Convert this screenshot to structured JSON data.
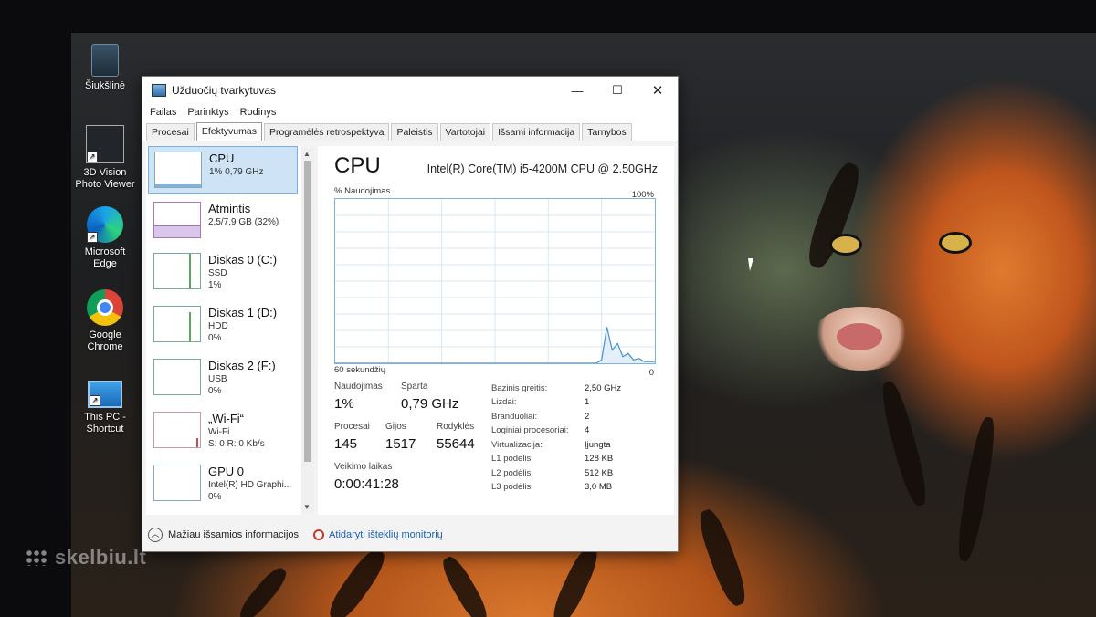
{
  "desktop": {
    "watermark": "skelbiu.lt",
    "icons": [
      {
        "name": "recycle-bin",
        "label": "Šiukšlinė"
      },
      {
        "name": "photo-viewer",
        "label": "3D Vision Photo Viewer"
      },
      {
        "name": "edge",
        "label": "Microsoft Edge"
      },
      {
        "name": "chrome",
        "label": "Google Chrome"
      },
      {
        "name": "this-pc",
        "label": "This PC - Shortcut"
      }
    ]
  },
  "window": {
    "title": "Užduočių tvarkytuvas",
    "controls": {
      "minimize": "—",
      "maximize": "☐",
      "close": "✕"
    },
    "menu": [
      "Failas",
      "Parinktys",
      "Rodinys"
    ],
    "tabs": [
      "Procesai",
      "Efektyvumas",
      "Programėlės retrospektyva",
      "Paleistis",
      "Vartotojai",
      "Išsami informacija",
      "Tarnybos"
    ],
    "active_tab": "Efektyvumas",
    "resources": [
      {
        "name": "CPU",
        "sub1": "1% 0,79 GHz",
        "sub2": "",
        "usage": 0.01,
        "selected": true
      },
      {
        "name": "Atmintis",
        "sub1": "2,5/7,9 GB (32%)",
        "sub2": "",
        "usage": 0.32
      },
      {
        "name": "Diskas 0 (C:)",
        "sub1": "SSD",
        "sub2": "1%",
        "usage": 0.01
      },
      {
        "name": "Diskas 1 (D:)",
        "sub1": "HDD",
        "sub2": "0%",
        "usage": 0.0
      },
      {
        "name": "Diskas 2 (F:)",
        "sub1": "USB",
        "sub2": "0%",
        "usage": 0.0
      },
      {
        "name": "„Wi-Fi“",
        "sub1": "Wi-Fi",
        "sub2": "S: 0 R: 0 Kb/s",
        "usage": 0.0
      },
      {
        "name": "GPU 0",
        "sub1": "Intel(R) HD Graphi...",
        "sub2": "0%",
        "usage": 0.0
      }
    ],
    "detail": {
      "heading": "CPU",
      "cpu_name": "Intel(R) Core(TM) i5-4200M CPU @ 2.50GHz",
      "graph_label": "% Naudojimas",
      "graph_max": "100%",
      "graph_time": "60 sekundžių",
      "graph_min": "0",
      "stats": {
        "usage_label": "Naudojimas",
        "usage": "1%",
        "speed_label": "Sparta",
        "speed": "0,79 GHz",
        "processes_label": "Procesai",
        "processes": "145",
        "threads_label": "Gijos",
        "threads": "1517",
        "handles_label": "Rodyklės",
        "handles": "55644",
        "uptime_label": "Veikimo laikas",
        "uptime": "0:00:41:28"
      },
      "specs": [
        {
          "label": "Bazinis greitis:",
          "value": "2,50 GHz"
        },
        {
          "label": "Lizdai:",
          "value": "1"
        },
        {
          "label": "Branduoliai:",
          "value": "2"
        },
        {
          "label": "Loginiai procesoriai:",
          "value": "4"
        },
        {
          "label": "Virtualizacija:",
          "value": "Įjungta"
        },
        {
          "label": "L1 podėlis:",
          "value": "128 KB"
        },
        {
          "label": "L2 podėlis:",
          "value": "512 KB"
        },
        {
          "label": "L3 podėlis:",
          "value": "3,0 MB"
        }
      ]
    },
    "footer": {
      "fewer_details": "Mažiau išsamios informacijos",
      "open_monitor": "Atidaryti išteklių monitorių"
    }
  },
  "chart_data": {
    "type": "area",
    "title": "",
    "xlabel": "60 sekundžių",
    "ylabel": "% Naudojimas",
    "ylim": [
      0,
      100
    ],
    "x": [
      0,
      2,
      4,
      6,
      8,
      10,
      12,
      14,
      16,
      18,
      20,
      22,
      24,
      26,
      28,
      30,
      32,
      34,
      36,
      38,
      40,
      42,
      44,
      46,
      48,
      50,
      52,
      54,
      56,
      58,
      60
    ],
    "series": [
      {
        "values": [
          0,
          0,
          0,
          0,
          0,
          0,
          0,
          0,
          0,
          0,
          0,
          0,
          0,
          0,
          0,
          0,
          0,
          0,
          0,
          0,
          0,
          0,
          0,
          0,
          0,
          0,
          0,
          0,
          0,
          0,
          0,
          0,
          0,
          0,
          0,
          0,
          0,
          0,
          0,
          0,
          0,
          0,
          0,
          0,
          0,
          0,
          0,
          0,
          0,
          0,
          2,
          22,
          8,
          12,
          4,
          6,
          2,
          3,
          1,
          1,
          1
        ]
      }
    ]
  }
}
